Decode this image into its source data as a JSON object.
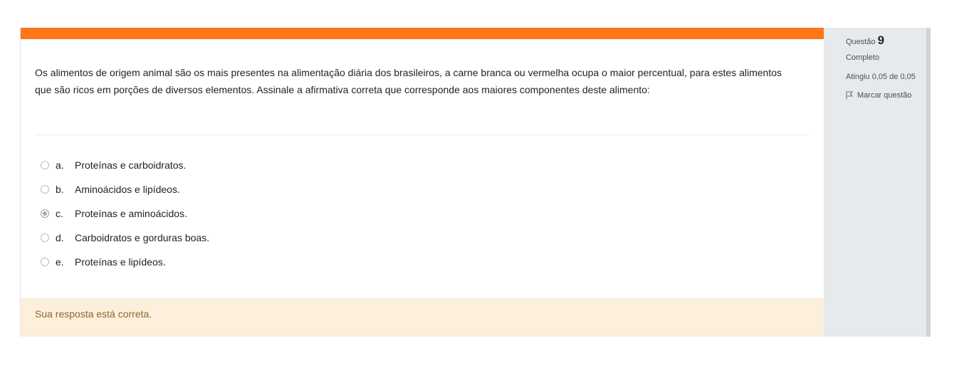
{
  "question": {
    "text": "Os alimentos de origem animal são os mais presentes na alimentação diária dos brasileiros, a carne branca ou vermelha ocupa o maior percentual, para estes alimentos que são ricos em porções de diversos elementos. Assinale a afirmativa correta que corresponde aos maiores componentes deste alimento:",
    "options": [
      {
        "letter": "a.",
        "text": "Proteínas e carboidratos.",
        "selected": false
      },
      {
        "letter": "b.",
        "text": "Aminoácidos e lipídeos.",
        "selected": false
      },
      {
        "letter": "c.",
        "text": "Proteínas e aminoácidos.",
        "selected": true
      },
      {
        "letter": "d.",
        "text": "Carboidratos e gorduras boas.",
        "selected": false
      },
      {
        "letter": "e.",
        "text": "Proteínas e lipídeos.",
        "selected": false
      }
    ],
    "feedback": "Sua resposta está correta."
  },
  "info": {
    "label": "Questão",
    "number": "9",
    "state": "Completo",
    "grade": "Atingiu 0,05 de 0,05",
    "flag_label": "Marcar questão"
  },
  "colors": {
    "accent_bar": "#ff7518",
    "feedback_bg": "#fcefdc",
    "feedback_text": "#8e662e",
    "info_bg": "#e7eaed"
  },
  "icons": {
    "flag": "flag-outline-icon"
  }
}
